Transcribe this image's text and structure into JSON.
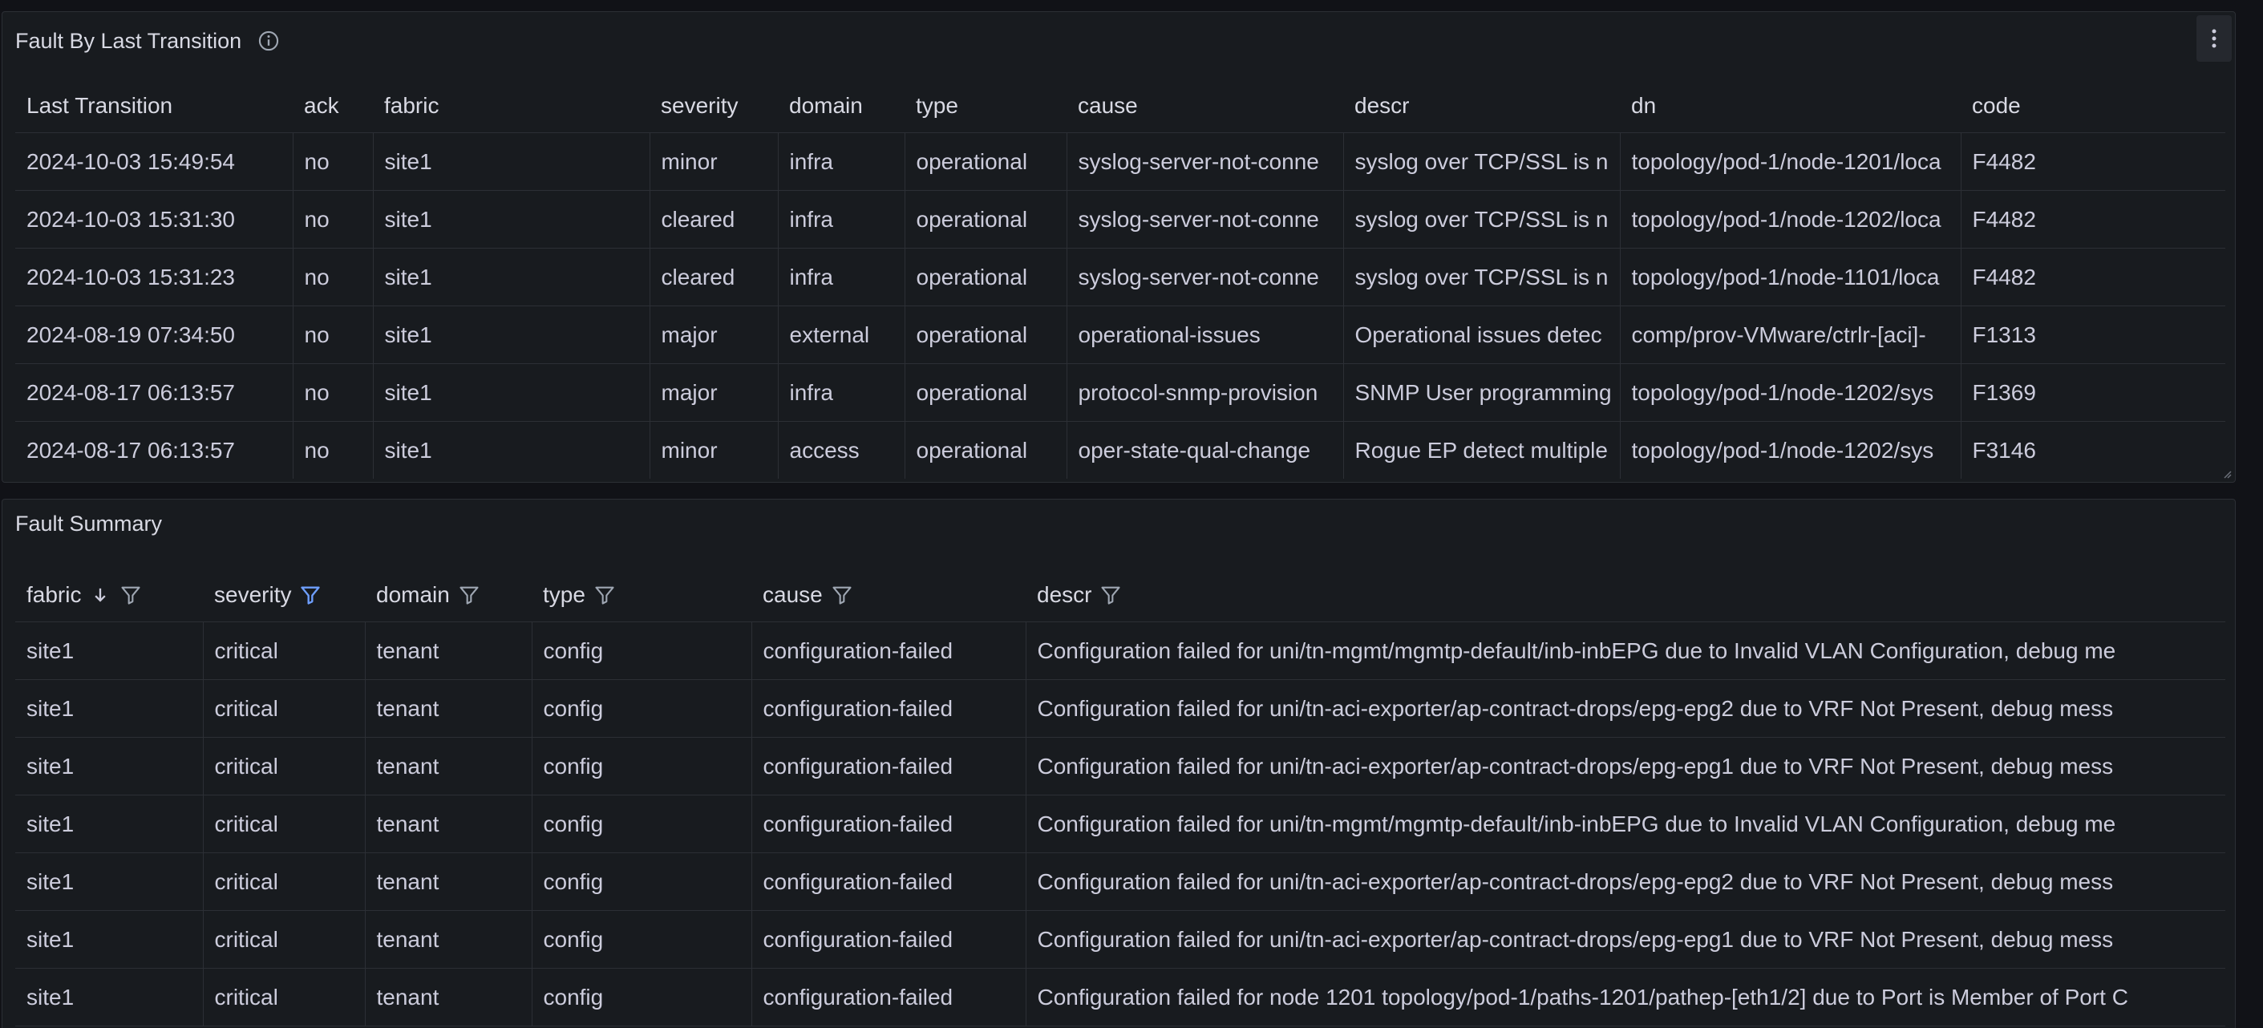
{
  "colors": {
    "background": "#111217",
    "panel": "#181b1f",
    "border": "#2c2f35",
    "text": "#ccccdc",
    "accent_filter": "#6e9fff"
  },
  "panel1": {
    "title": "Fault By Last Transition",
    "columns": [
      "Last Transition",
      "ack",
      "fabric",
      "severity",
      "domain",
      "type",
      "cause",
      "descr",
      "dn",
      "code"
    ],
    "rows": [
      [
        "2024-10-03 15:49:54",
        "no",
        "site1",
        "minor",
        "infra",
        "operational",
        "syslog-server-not-conne",
        "syslog over TCP/SSL is n",
        "topology/pod-1/node-1201/loca",
        "F4482"
      ],
      [
        "2024-10-03 15:31:30",
        "no",
        "site1",
        "cleared",
        "infra",
        "operational",
        "syslog-server-not-conne",
        "syslog over TCP/SSL is n",
        "topology/pod-1/node-1202/loca",
        "F4482"
      ],
      [
        "2024-10-03 15:31:23",
        "no",
        "site1",
        "cleared",
        "infra",
        "operational",
        "syslog-server-not-conne",
        "syslog over TCP/SSL is n",
        "topology/pod-1/node-1101/loca",
        "F4482"
      ],
      [
        "2024-08-19 07:34:50",
        "no",
        "site1",
        "major",
        "external",
        "operational",
        "operational-issues",
        "Operational issues detec",
        "comp/prov-VMware/ctrlr-[aci]-",
        "F1313"
      ],
      [
        "2024-08-17 06:13:57",
        "no",
        "site1",
        "major",
        "infra",
        "operational",
        "protocol-snmp-provision",
        "SNMP User programming",
        "topology/pod-1/node-1202/sys",
        "F1369"
      ],
      [
        "2024-08-17 06:13:57",
        "no",
        "site1",
        "minor",
        "access",
        "operational",
        "oper-state-qual-change",
        "Rogue EP detect multiple",
        "topology/pod-1/node-1202/sys",
        "F3146"
      ]
    ]
  },
  "panel2": {
    "title": "Fault Summary",
    "columns": [
      "fabric",
      "severity",
      "domain",
      "type",
      "cause",
      "descr"
    ],
    "rows": [
      [
        "site1",
        "critical",
        "tenant",
        "config",
        "configuration-failed",
        "Configuration failed for uni/tn-mgmt/mgmtp-default/inb-inbEPG due to Invalid VLAN Configuration, debug me"
      ],
      [
        "site1",
        "critical",
        "tenant",
        "config",
        "configuration-failed",
        "Configuration failed for uni/tn-aci-exporter/ap-contract-drops/epg-epg2 due to VRF Not Present, debug mess"
      ],
      [
        "site1",
        "critical",
        "tenant",
        "config",
        "configuration-failed",
        "Configuration failed for uni/tn-aci-exporter/ap-contract-drops/epg-epg1 due to VRF Not Present, debug mess"
      ],
      [
        "site1",
        "critical",
        "tenant",
        "config",
        "configuration-failed",
        "Configuration failed for uni/tn-mgmt/mgmtp-default/inb-inbEPG due to Invalid VLAN Configuration, debug me"
      ],
      [
        "site1",
        "critical",
        "tenant",
        "config",
        "configuration-failed",
        "Configuration failed for uni/tn-aci-exporter/ap-contract-drops/epg-epg2 due to VRF Not Present, debug mess"
      ],
      [
        "site1",
        "critical",
        "tenant",
        "config",
        "configuration-failed",
        "Configuration failed for uni/tn-aci-exporter/ap-contract-drops/epg-epg1 due to VRF Not Present, debug mess"
      ],
      [
        "site1",
        "critical",
        "tenant",
        "config",
        "configuration-failed",
        "Configuration failed for node 1201 topology/pod-1/paths-1201/pathep-[eth1/2] due to Port is Member of Port C"
      ]
    ]
  }
}
